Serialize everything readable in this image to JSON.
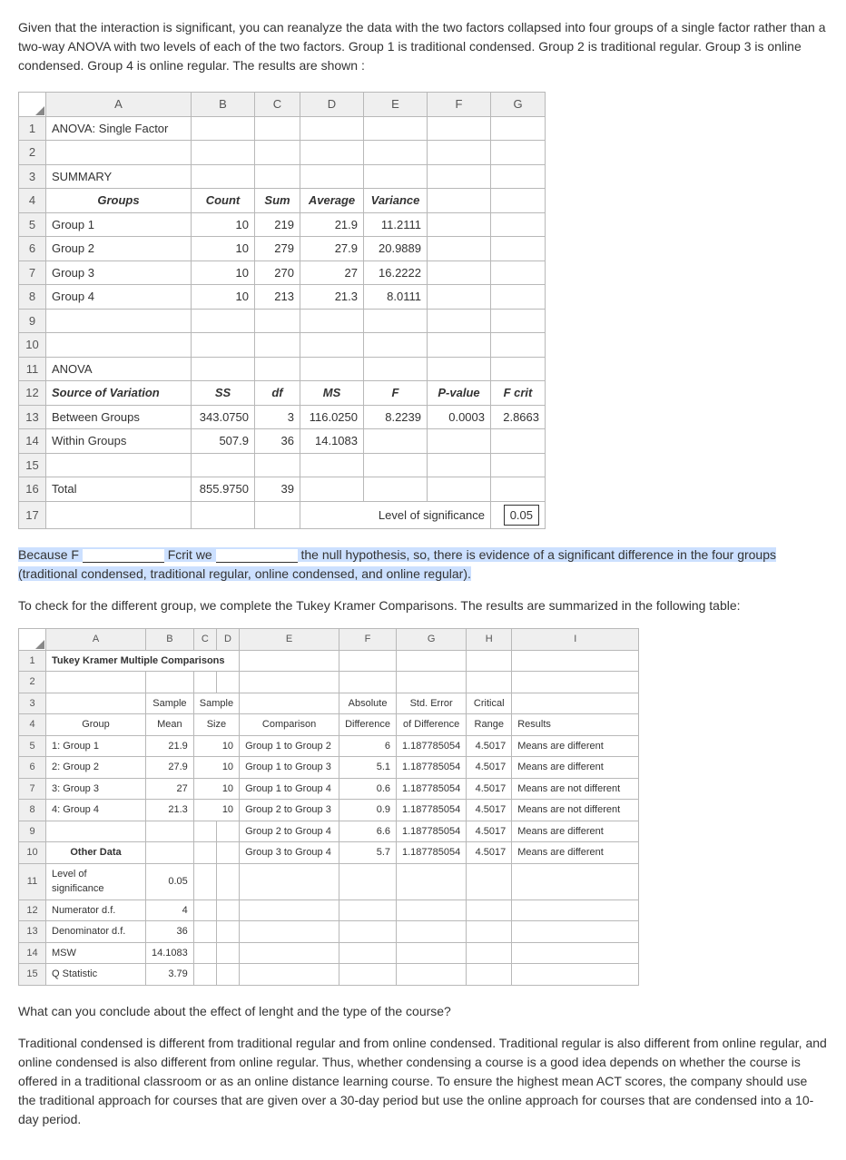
{
  "intro_text": "Given that the interaction is significant, you can reanalyze the data with the two factors collapsed into four groups of a single factor rather than a two-way ANOVA with two levels of each of the two factors.  Group 1 is traditional condensed. Group 2 is traditional regular. Group 3 is online condensed. Group 4 is online regular. The results are shown :",
  "sheet1": {
    "cols": [
      "A",
      "B",
      "C",
      "D",
      "E",
      "F",
      "G"
    ],
    "title": "ANOVA: Single Factor",
    "summary_label": "SUMMARY",
    "headers": {
      "groups": "Groups",
      "count": "Count",
      "sum": "Sum",
      "average": "Average",
      "variance": "Variance"
    },
    "rows": [
      {
        "name": "Group 1",
        "count": "10",
        "sum": "219",
        "avg": "21.9",
        "var": "11.2111"
      },
      {
        "name": "Group 2",
        "count": "10",
        "sum": "279",
        "avg": "27.9",
        "var": "20.9889"
      },
      {
        "name": "Group 3",
        "count": "10",
        "sum": "270",
        "avg": "27",
        "var": "16.2222"
      },
      {
        "name": "Group 4",
        "count": "10",
        "sum": "213",
        "avg": "21.3",
        "var": "8.0111"
      }
    ],
    "anova_label": "ANOVA",
    "anova_headers": {
      "source": "Source of Variation",
      "ss": "SS",
      "df": "df",
      "ms": "MS",
      "f": "F",
      "pvalue": "P-value",
      "fcrit": "F crit"
    },
    "between": {
      "name": "Between Groups",
      "ss": "343.0750",
      "df": "3",
      "ms": "116.0250",
      "f": "8.2239",
      "pvalue": "0.0003",
      "fcrit": "2.8663"
    },
    "within": {
      "name": "Within Groups",
      "ss": "507.9",
      "df": "36",
      "ms": "14.1083"
    },
    "total": {
      "name": "Total",
      "ss": "855.9750",
      "df": "39"
    },
    "sig_label": "Level of significance",
    "sig_value": "0.05"
  },
  "statement1": {
    "prefix": "Because F ",
    "mid": " Fcrit  we ",
    "suffix": " the null hypothesis, so, there is evidence of a significant difference in the four groups (traditional condensed, traditional regular, online condensed, and online regular)."
  },
  "tukey_intro": "To check for the different group, we complete the Tukey Kramer Comparisons. The results are summarized in the following table:",
  "sheet2": {
    "cols": [
      "A",
      "B",
      "C",
      "D",
      "E",
      "F",
      "G",
      "H",
      "I"
    ],
    "title": "Tukey Kramer Multiple Comparisons",
    "headers": {
      "group": "Group",
      "mean_top": "Sample",
      "mean_bot": "Mean",
      "size_top": "Sample",
      "size_bot": "Size",
      "comparison": "Comparison",
      "absdiff_top": "Absolute",
      "absdiff_bot": "Difference",
      "stderr_top": "Std. Error",
      "stderr_bot": "of Difference",
      "crit_top": "Critical",
      "crit_bot": "Range",
      "results": "Results"
    },
    "groups": [
      {
        "label": "1: Group 1",
        "mean": "21.9",
        "size": "10"
      },
      {
        "label": "2: Group 2",
        "mean": "27.9",
        "size": "10"
      },
      {
        "label": "3: Group 3",
        "mean": "27",
        "size": "10"
      },
      {
        "label": "4: Group 4",
        "mean": "21.3",
        "size": "10"
      }
    ],
    "comparisons": [
      {
        "name": "Group 1 to Group 2",
        "absdiff": "6",
        "stderr": "1.187785054",
        "crit": "4.5017",
        "result": "Means are different"
      },
      {
        "name": "Group 1 to Group 3",
        "absdiff": "5.1",
        "stderr": "1.187785054",
        "crit": "4.5017",
        "result": "Means are different"
      },
      {
        "name": "Group 1 to Group 4",
        "absdiff": "0.6",
        "stderr": "1.187785054",
        "crit": "4.5017",
        "result": "Means are not different"
      },
      {
        "name": "Group 2 to Group 3",
        "absdiff": "0.9",
        "stderr": "1.187785054",
        "crit": "4.5017",
        "result": "Means are not different"
      },
      {
        "name": "Group 2 to Group 4",
        "absdiff": "6.6",
        "stderr": "1.187785054",
        "crit": "4.5017",
        "result": "Means are different"
      },
      {
        "name": "Group 3 to Group 4",
        "absdiff": "5.7",
        "stderr": "1.187785054",
        "crit": "4.5017",
        "result": "Means are different"
      }
    ],
    "other_label": "Other Data",
    "other": [
      {
        "name": "Level of significance",
        "val": "0.05"
      },
      {
        "name": "Numerator d.f.",
        "val": "4"
      },
      {
        "name": "Denominator d.f.",
        "val": "36"
      },
      {
        "name": "MSW",
        "val": "14.1083"
      },
      {
        "name": "Q Statistic",
        "val": "3.79"
      }
    ]
  },
  "conclude_q": "What can you conclude about the effect of lenght and the type of the course?",
  "conclude_a": "Traditional condensed is different from traditional regular and from online condensed. Traditional regular is also different from online regular, and online condensed is also different from online regular. Thus, whether condensing a course is a good idea depends on whether the course is offered in a traditional classroom or as an online distance learning course. To ensure the highest mean ACT scores, the company should use the traditional approach for courses that are given over a 30-day period but use the online approach for courses that are condensed into a 10-day period."
}
